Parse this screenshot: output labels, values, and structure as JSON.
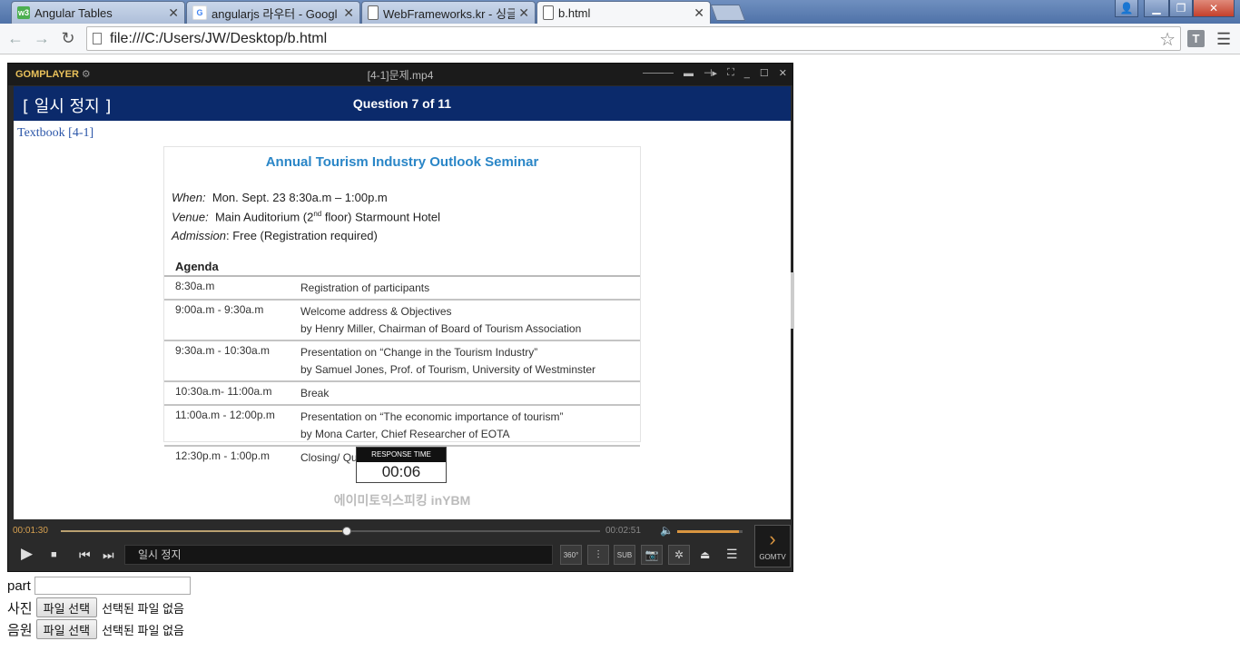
{
  "browser": {
    "tabs": [
      {
        "label": "Angular Tables",
        "favicon": "w3schools-icon"
      },
      {
        "label": "angularjs 라우터 - Googl",
        "favicon": "google-icon"
      },
      {
        "label": "WebFrameworks.kr - 싱글",
        "favicon": "page-icon"
      },
      {
        "label": "b.html",
        "favicon": "page-icon",
        "active": true
      }
    ],
    "url": "file:///C:/Users/JW/Desktop/b.html",
    "extension_label": "T"
  },
  "player": {
    "logo": "GOMPLAYER",
    "title": "[4-1]문제.mp4",
    "current_time": "00:01:30",
    "total_time": "00:02:51",
    "progress_fraction": 0.53,
    "volume_fraction": 0.95,
    "status_text": "일시 정지",
    "buttons": {
      "sub": "SUB",
      "vr": "360°",
      "gomtv": "GOMTV"
    },
    "screen": {
      "pause_label": "[ 일시 정지 ]",
      "question": "Question 7 of 11",
      "textbook": "Textbook [4-1]",
      "flyer": {
        "title": "Annual Tourism Industry Outlook Seminar",
        "when_label": "When:",
        "when_value": "Mon. Sept. 23  8:30a.m – 1:00p.m",
        "venue_label": "Venue:",
        "venue_value_pre": "Main Auditorium (2",
        "venue_sup": "nd",
        "venue_value_post": " floor) Starmount Hotel",
        "admission_label": "Admission",
        "admission_value": ": Free (Registration required)",
        "agenda_heading": "Agenda",
        "agenda": [
          {
            "time": "8:30a.m",
            "line1": "Registration of participants",
            "line2": ""
          },
          {
            "time": "9:00a.m - 9:30a.m",
            "line1": "Welcome address & Objectives",
            "line2": "by Henry Miller, Chairman of Board of Tourism Association"
          },
          {
            "time": "9:30a.m - 10:30a.m",
            "line1": "Presentation on “Change in the Tourism Industry”",
            "line2": "by Samuel Jones, Prof. of Tourism, University of Westminster"
          },
          {
            "time": "10:30a.m- 11:00a.m",
            "line1": "Break",
            "line2": ""
          },
          {
            "time": "11:00a.m - 12:00p.m",
            "line1": "Presentation on “The economic importance of tourism”",
            "line2": "by Mona Carter, Chief Researcher of EOTA"
          },
          {
            "time": "12:30p.m - 1:00p.m",
            "line1": "Closing/ Questions & Answer",
            "line2": ""
          }
        ]
      },
      "response_label": "RESPONSE TIME",
      "response_value": "00:06",
      "watermark": "에이미토익스피킹 inYBM"
    }
  },
  "form": {
    "part_label": "part",
    "part_value": "",
    "photo_label": "사진",
    "audio_label": "음원",
    "file_button": "파일 선택",
    "no_file": "선택된 파일 없음"
  }
}
